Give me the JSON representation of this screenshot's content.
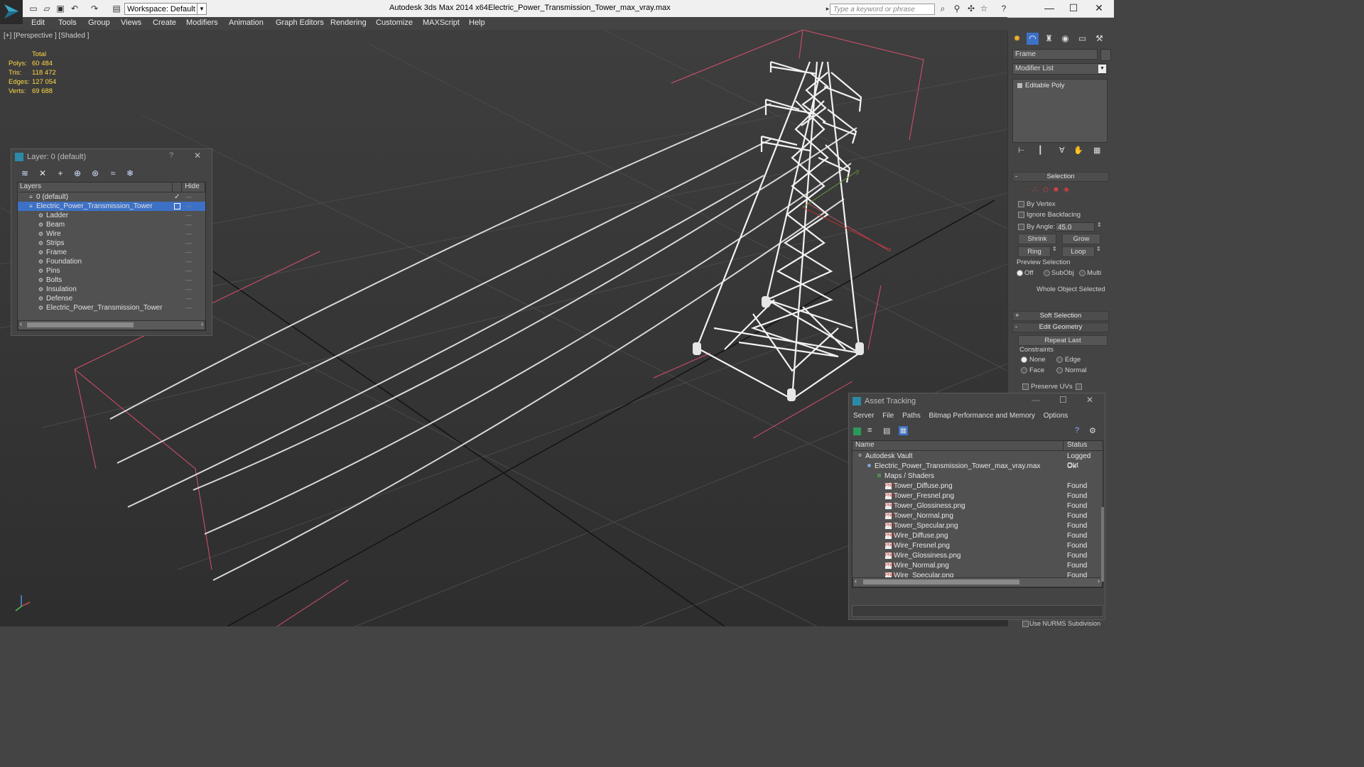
{
  "titlebar": {
    "workspace": "Workspace: Default",
    "app_title": "Autodesk 3ds Max  2014 x64",
    "file_title": "Electric_Power_Transmission_Tower_max_vray.max",
    "search_placeholder": "Type a keyword or phrase"
  },
  "menu": [
    "Edit",
    "Tools",
    "Group",
    "Views",
    "Create",
    "Modifiers",
    "Animation",
    "Graph Editors",
    "Rendering",
    "Customize",
    "MAXScript",
    "Help"
  ],
  "viewport": {
    "label": "[+] [Perspective ] [Shaded ]",
    "stats_header": "Total",
    "stats": [
      {
        "k": "Polys:",
        "v": "60 484"
      },
      {
        "k": "Tris:",
        "v": "118 472"
      },
      {
        "k": "Edges:",
        "v": "127 054"
      },
      {
        "k": "Verts:",
        "v": "69 688"
      }
    ],
    "axis_x": "x",
    "axis_y": "y"
  },
  "layer_window": {
    "title": "Layer: 0 (default)",
    "help": "?",
    "close": "✕",
    "col_layers": "Layers",
    "col_hide": "Hide",
    "items": [
      {
        "label": "0 (default)",
        "level": 0
      },
      {
        "label": "Electric_Power_Transmission_Tower",
        "level": 0,
        "selected": true
      },
      {
        "label": "Ladder",
        "level": 1
      },
      {
        "label": "Beam",
        "level": 1
      },
      {
        "label": "Wire",
        "level": 1
      },
      {
        "label": "Strips",
        "level": 1
      },
      {
        "label": "Frame",
        "level": 1
      },
      {
        "label": "Foundation",
        "level": 1
      },
      {
        "label": "Pins",
        "level": 1
      },
      {
        "label": "Bolts",
        "level": 1
      },
      {
        "label": "Insulation",
        "level": 1
      },
      {
        "label": "Defense",
        "level": 1
      },
      {
        "label": "Electric_Power_Transmission_Tower",
        "level": 1
      }
    ],
    "hide_marker": "—"
  },
  "command_panel": {
    "object_name": "Frame",
    "modifier_list": "Modifier List",
    "stack_item": "Editable Poly",
    "selection_header": "Selection",
    "by_vertex": "By Vertex",
    "ignore_backfacing": "Ignore Backfacing",
    "by_angle": "By Angle:",
    "angle_value": "45.0",
    "shrink": "Shrink",
    "grow": "Grow",
    "ring": "Ring",
    "loop": "Loop",
    "preview_selection": "Preview Selection",
    "preview_off": "Off",
    "preview_subobj": "SubObj",
    "preview_multi": "Multi",
    "whole_object": "Whole Object Selected",
    "soft_selection": "Soft Selection",
    "edit_geometry": "Edit Geometry",
    "repeat_last": "Repeat Last",
    "constraints": "Constraints",
    "c_none": "None",
    "c_edge": "Edge",
    "c_face": "Face",
    "c_normal": "Normal",
    "preserve_uvs": "Preserve UVs",
    "use_nurms": "Use NURMS Subdivision",
    "plus": "+",
    "minus": "-"
  },
  "asset_window": {
    "title": "Asset Tracking",
    "menu": [
      "Server",
      "File",
      "Paths",
      "Bitmap Performance and Memory",
      "Options"
    ],
    "col_name": "Name",
    "col_status": "Status",
    "rows": [
      {
        "name": "Autodesk Vault",
        "status": "Logged Out",
        "indent": 18,
        "icon": "vault-icon"
      },
      {
        "name": "Electric_Power_Transmission_Tower_max_vray.max",
        "status": "Ok",
        "indent": 31,
        "icon": "max-file-icon"
      },
      {
        "name": "Maps / Shaders",
        "status": "",
        "indent": 45,
        "icon": "maps-folder-icon"
      },
      {
        "name": "Tower_Diffuse.png",
        "status": "Found",
        "indent": 58,
        "icon": "png-icon"
      },
      {
        "name": "Tower_Fresnel.png",
        "status": "Found",
        "indent": 58,
        "icon": "png-icon"
      },
      {
        "name": "Tower_Glossiness.png",
        "status": "Found",
        "indent": 58,
        "icon": "png-icon"
      },
      {
        "name": "Tower_Normal.png",
        "status": "Found",
        "indent": 58,
        "icon": "png-icon"
      },
      {
        "name": "Tower_Specular.png",
        "status": "Found",
        "indent": 58,
        "icon": "png-icon"
      },
      {
        "name": "Wire_Diffuse.png",
        "status": "Found",
        "indent": 58,
        "icon": "png-icon"
      },
      {
        "name": "Wire_Fresnel.png",
        "status": "Found",
        "indent": 58,
        "icon": "png-icon"
      },
      {
        "name": "Wire_Glossiness.png",
        "status": "Found",
        "indent": 58,
        "icon": "png-icon"
      },
      {
        "name": "Wire_Normal.png",
        "status": "Found",
        "indent": 58,
        "icon": "png-icon"
      },
      {
        "name": "Wire_Specular.png",
        "status": "Found",
        "indent": 58,
        "icon": "png-icon"
      }
    ]
  },
  "colors": {
    "selection": "#3d71c6",
    "stats": "#ffd84a",
    "grid_red": "#e0506a"
  }
}
